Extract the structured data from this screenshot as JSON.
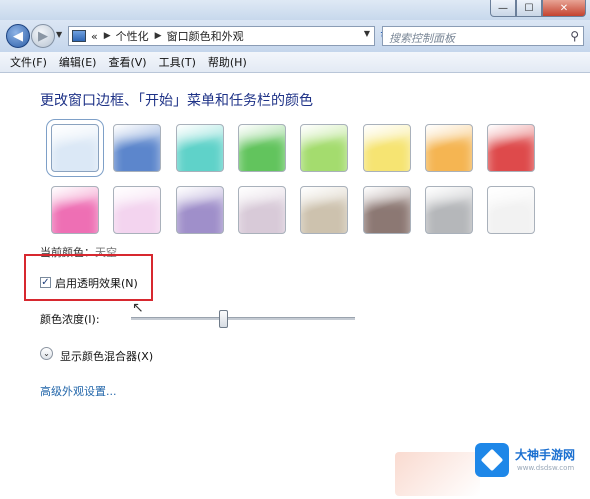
{
  "titlebar": {
    "buttons": [
      {
        "name": "minimize",
        "glyph": "—"
      },
      {
        "name": "maximize",
        "glyph": "☐"
      },
      {
        "name": "close",
        "glyph": "✕"
      }
    ]
  },
  "nav": {
    "back_glyph": "◀",
    "forward_glyph": "▶",
    "history_glyph": "▼",
    "breadcrumb_prefix": "«",
    "breadcrumbs": [
      "个性化",
      "窗口颜色和外观"
    ],
    "breadcrumb_sep": "▶",
    "refresh_glyph": "↻",
    "search_placeholder": "搜索控制面板",
    "search_icon": "search-icon"
  },
  "menu": [
    "文件(F)",
    "编辑(E)",
    "查看(V)",
    "工具(T)",
    "帮助(H)"
  ],
  "heading": "更改窗口边框、「开始」菜单和任务栏的颜色",
  "swatches": {
    "row1": [
      {
        "color": "#dbe8f6",
        "selected": true
      },
      {
        "color": "#5c86cc"
      },
      {
        "color": "#5fd2c9"
      },
      {
        "color": "#62c45d"
      },
      {
        "color": "#a4dc6e"
      },
      {
        "color": "#f6e472"
      },
      {
        "color": "#f5b552"
      },
      {
        "color": "#de4a4b"
      }
    ],
    "row2": [
      {
        "color": "#ee6fb4"
      },
      {
        "color": "#f3d4ef"
      },
      {
        "color": "#9f8fca"
      },
      {
        "color": "#d8cad8"
      },
      {
        "color": "#cdc2ae"
      },
      {
        "color": "#8c7873"
      },
      {
        "color": "#b5b7ba"
      },
      {
        "color": "#f2f2f2"
      }
    ]
  },
  "current_color_label": "当前颜色：",
  "current_color_value": "天空",
  "transparency": {
    "label": "启用透明效果(N)",
    "checked": true,
    "check_glyph": "✓"
  },
  "intensity": {
    "label": "颜色浓度(I):",
    "value_percent": 41
  },
  "mixer": {
    "label": "显示颜色混合器(X)",
    "glyph": "⌄"
  },
  "advanced_link": "高级外观设置...",
  "watermark": {
    "title": "大神手游网",
    "url": "www.dsdsw.com"
  },
  "colors": {
    "highlight_box": "#d7282f",
    "heading": "#1e3287",
    "link": "#2266aa"
  }
}
